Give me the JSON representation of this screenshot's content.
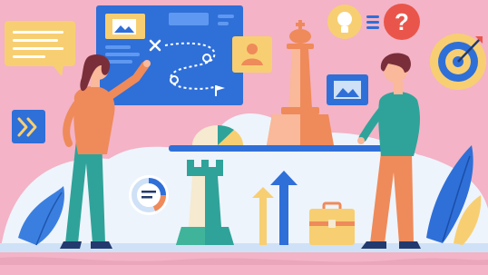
{
  "colors": {
    "background": "#f4b3c6",
    "board": "#2f6fd8",
    "board_light": "#5f98f0",
    "card_yellow": "#f7cf72",
    "orange": "#ef8a5a",
    "peach": "#f9b99a",
    "teal": "#2fa39a",
    "green": "#3fb49a",
    "navy": "#233a6e",
    "blue": "#3a7fe0",
    "light_blue": "#cfe1f6",
    "cream": "#f6ead0",
    "red": "#e9554a",
    "white": "#ffffff"
  },
  "icons": [
    "speech-bubble-icon",
    "double-chevron-right-icon",
    "strategy-board-icon",
    "image-icon",
    "user-card-icon",
    "route-plan-icon",
    "flag-icon",
    "chess-queen-icon",
    "chess-rook-icon",
    "pie-chart-icon",
    "donut-chart-icon",
    "lightbulb-icon",
    "equals-icon",
    "question-mark-icon",
    "target-icon",
    "arrow-up-icon",
    "briefcase-icon",
    "leaf-icon"
  ],
  "labels": {
    "question_glyph": "?"
  }
}
